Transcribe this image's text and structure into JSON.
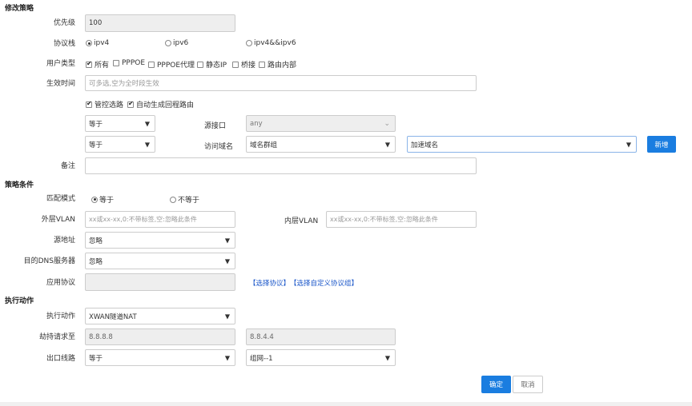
{
  "sections": {
    "modify": "修改策略",
    "conditions": "策略条件",
    "actions": "执行动作"
  },
  "priority": {
    "label": "优先级",
    "value": "100"
  },
  "protocol_stack": {
    "label": "协议栈",
    "options": [
      {
        "label": "ipv4",
        "checked": true
      },
      {
        "label": "ipv6",
        "checked": false
      },
      {
        "label": "ipv4&&ipv6",
        "checked": false
      }
    ]
  },
  "user_type": {
    "label": "用户类型",
    "options": [
      {
        "label": "所有",
        "checked": true
      },
      {
        "label": "PPPOE",
        "checked": false
      },
      {
        "label": "PPPOE代理",
        "checked": false
      },
      {
        "label": "静态IP",
        "checked": false
      },
      {
        "label": "桥接",
        "checked": false
      },
      {
        "label": "路由内部",
        "checked": false
      }
    ]
  },
  "effective_time": {
    "label": "生效时间",
    "placeholder": "可多选,空为全时段生效"
  },
  "flags": [
    {
      "label": "管控选路",
      "checked": true
    },
    {
      "label": "自动生成回程路由",
      "checked": true
    }
  ],
  "src_iface_row": {
    "op": "等于",
    "label": "源接口",
    "value": "any"
  },
  "dest_domain_row": {
    "op": "等于",
    "label": "访问域名",
    "group": "域名群组",
    "domain": "加速域名",
    "add_button": "新增"
  },
  "remark": {
    "label": "备注",
    "value": ""
  },
  "match_mode": {
    "label": "匹配模式",
    "options": [
      {
        "label": "等于",
        "checked": true
      },
      {
        "label": "不等于",
        "checked": false
      }
    ]
  },
  "outer_vlan": {
    "label": "外层VLAN",
    "placeholder": "xx或xx-xx,0:不带标签,空:忽略此条件"
  },
  "inner_vlan": {
    "label": "内层VLAN",
    "placeholder": "xx或xx-xx,0:不带标签,空:忽略此条件"
  },
  "src_addr": {
    "label": "源地址",
    "value": "忽略"
  },
  "dest_dns": {
    "label": "目的DNS服务器",
    "value": "忽略"
  },
  "app_protocol": {
    "label": "应用协议",
    "value": "",
    "link1": "【选择协议】",
    "link2": "【选择自定义协议组】"
  },
  "action": {
    "label": "执行动作",
    "value": "XWAN隧道NAT"
  },
  "hijack": {
    "label": "劫持请求至",
    "value1": "8.8.8.8",
    "value2": "8.8.4.4"
  },
  "exit_line": {
    "label": "出口线路",
    "op": "等于",
    "value": "组网--1"
  },
  "buttons": {
    "confirm": "确定",
    "cancel": "取消"
  },
  "colors": {
    "primary": "#1a7de0",
    "link": "#1a56c9"
  }
}
